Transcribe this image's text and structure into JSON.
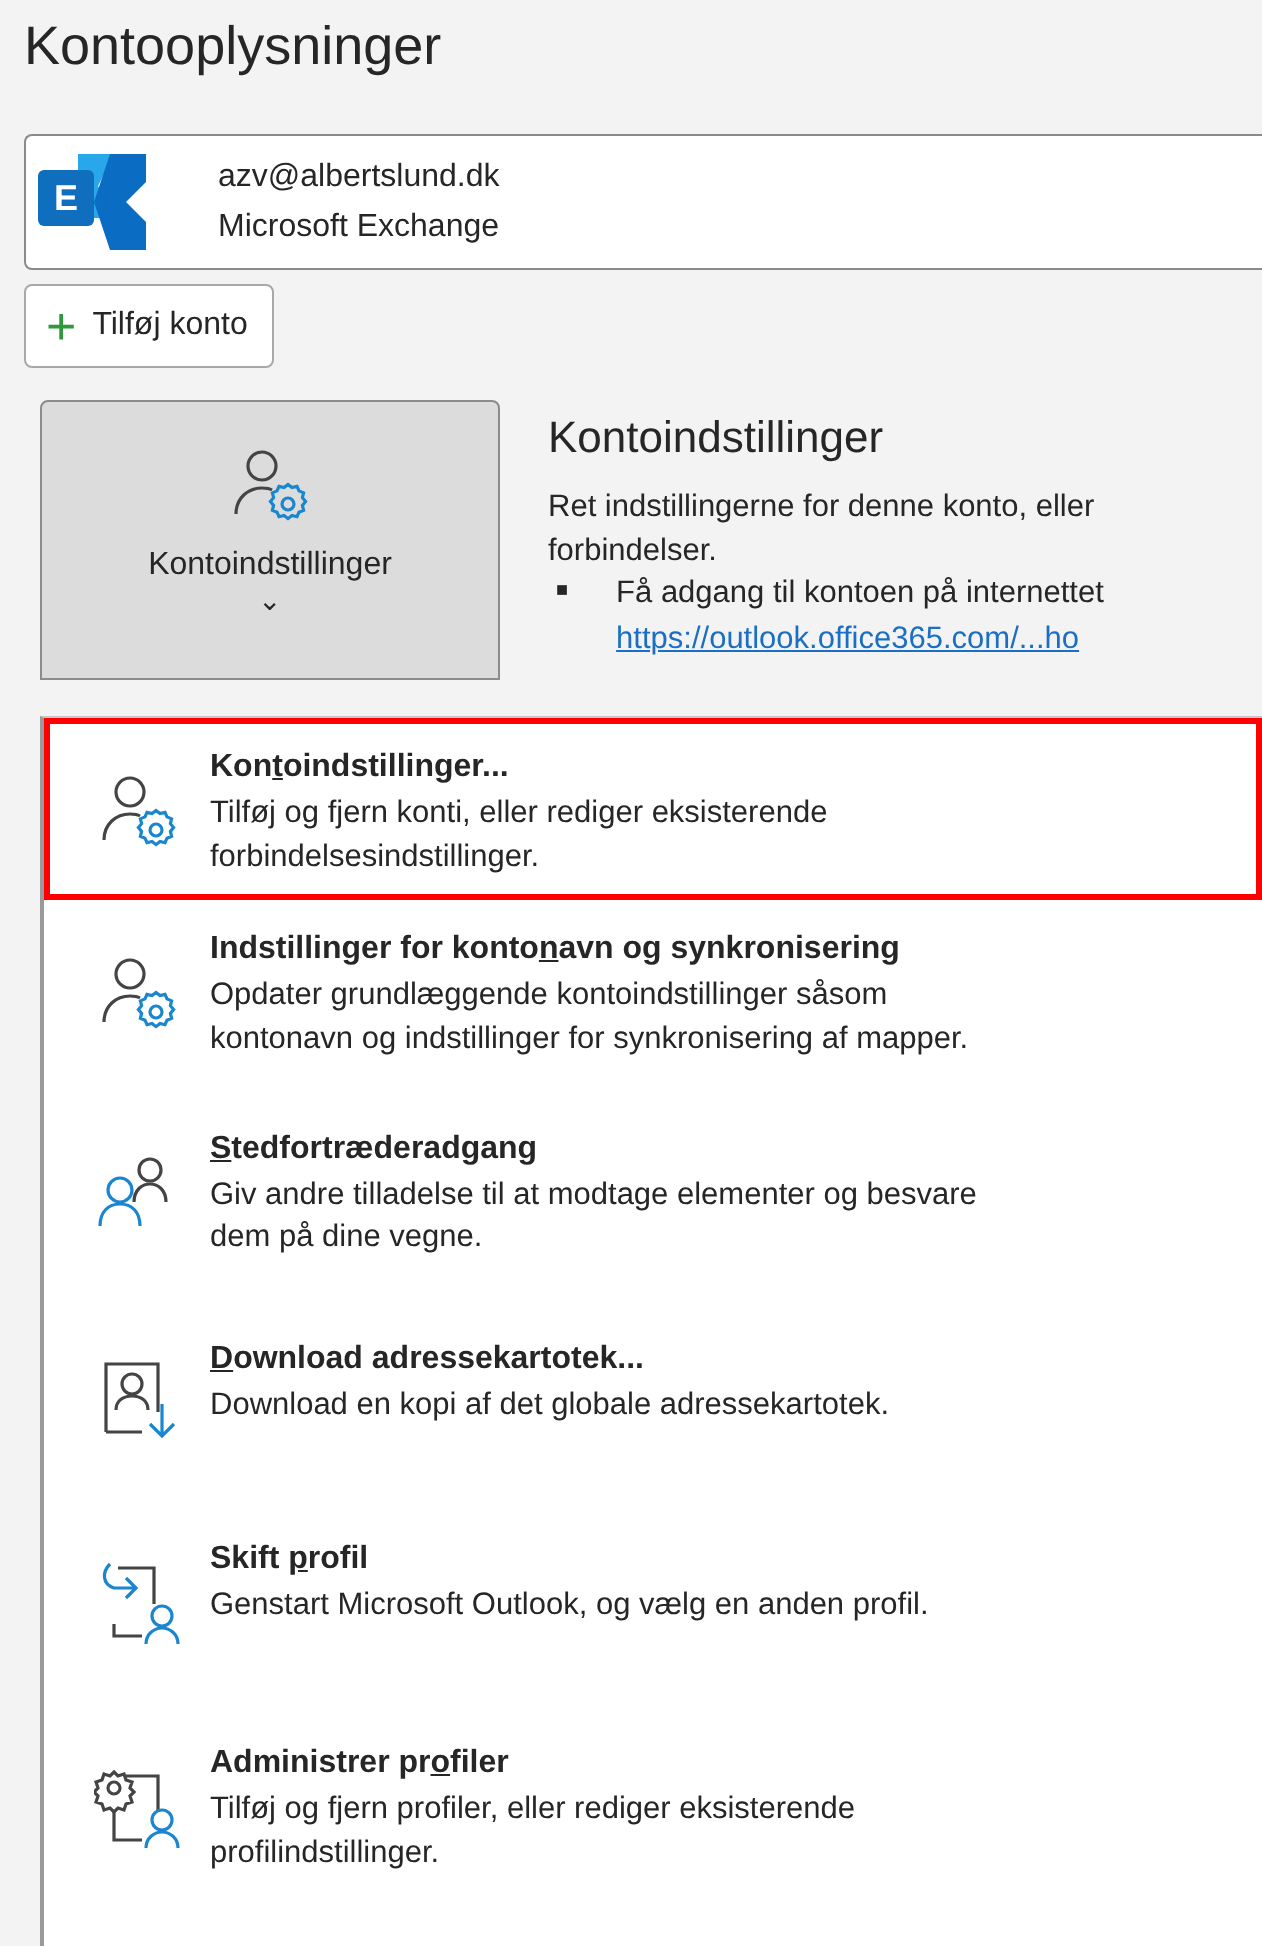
{
  "page_title": "Kontooplysninger",
  "account": {
    "logo_letter": "E",
    "email": "azv@albertslund.dk",
    "type": "Microsoft Exchange"
  },
  "add_account_button": {
    "icon": "+",
    "label": "Tilføj konto"
  },
  "settings_button": {
    "label": "Kontoindstillinger",
    "caret": "⌄",
    "expanded": true
  },
  "settings_section": {
    "heading": "Kontoindstillinger",
    "description": "Ret indstillingerne for denne konto, eller",
    "description_2": "forbindelser.",
    "bullet_icon": "■",
    "bullet": "Få adgang til kontoen på internettet",
    "link": "https://outlook.office365.com/...ho"
  },
  "menu_items": [
    {
      "kind": "account-gear",
      "title": {
        "before": "Kon",
        "access_key": "t",
        "after": "oindstillinger..."
      },
      "description": [
        "Tilføj og fjern konti, eller rediger eksisterende",
        "forbindelsesindstillinger."
      ],
      "highlighted": true
    },
    {
      "kind": "account-gear",
      "title": {
        "before": "Indstillinger for konto",
        "access_key": "n",
        "after": "avn og synkronisering"
      },
      "description": [
        "Opdater grundlæggende kontoindstillinger såsom",
        "kontonavn og indstillinger for synkronisering af mapper."
      ],
      "highlighted": false
    },
    {
      "kind": "delegate",
      "title": {
        "access_key": "S",
        "after": "tedfortræderadgang"
      },
      "description": [
        "Giv andre tilladelse til at modtage elementer og besvare",
        "dem på dine vegne."
      ],
      "highlighted": false
    },
    {
      "kind": "address-book",
      "title": {
        "access_key": "D",
        "after": "ownload adressekartotek..."
      },
      "description": [
        "Download en kopi af det globale adressekartotek."
      ],
      "highlighted": false
    },
    {
      "kind": "switch-profile",
      "title": {
        "before": "Skift ",
        "access_key": "p",
        "after": "rofil"
      },
      "description": [
        "Genstart Microsoft Outlook, og vælg en anden profil."
      ],
      "highlighted": false
    },
    {
      "kind": "manage-profiles",
      "title": {
        "before": "Administrer pr",
        "access_key": "o",
        "after": "filer"
      },
      "description": [
        "Tilføj og fjern profiler, eller rediger eksisterende",
        "profilindstillinger."
      ],
      "highlighted": false
    }
  ]
}
